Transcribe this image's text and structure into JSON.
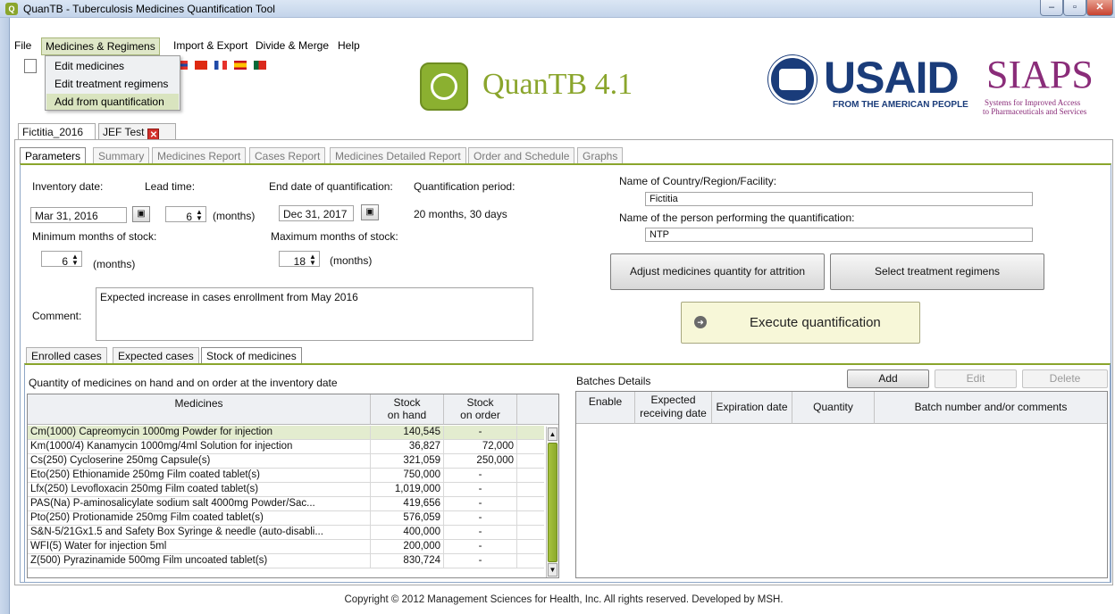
{
  "window": {
    "title": "QuanTB - Tuberculosis Medicines Quantification Tool",
    "minimize_glyph": "–",
    "maximize_glyph": "▫",
    "close_glyph": "✕"
  },
  "menubar": {
    "items": [
      "File",
      "Medicines & Regimens",
      "Import & Export",
      "Divide & Merge",
      "Help"
    ]
  },
  "dropdown": {
    "items": [
      "Edit medicines",
      "Edit treatment regimens",
      "Add from quantification"
    ],
    "highlighted_index": 2
  },
  "branding": {
    "app_logo_text": "QuanTB 4.1",
    "usaid_text": "USAID",
    "usaid_tagline": "FROM THE AMERICAN PEOPLE",
    "siaps_text": "SIAPS",
    "siaps_line1": "Systems for Improved Access",
    "siaps_line2": "to Pharmaceuticals and Services"
  },
  "doc_tabs": [
    {
      "label": "Fictitia_2016"
    },
    {
      "label": "JEF Test"
    }
  ],
  "subtabs": [
    "Parameters",
    "Summary",
    "Medicines Report",
    "Cases Report",
    "Medicines Detailed Report",
    "Order and Schedule",
    "Graphs"
  ],
  "params": {
    "inventory_date_label": "Inventory date:",
    "inventory_date": "Mar 31, 2016",
    "lead_time_label": "Lead time:",
    "lead_time": "6",
    "lead_time_unit": "(months)",
    "end_date_label": "End date of quantification:",
    "end_date": "Dec 31, 2017",
    "period_label": "Quantification period:",
    "period_value": "20 months, 30 days",
    "min_stock_label": "Minimum months of stock:",
    "min_stock": "6",
    "min_stock_unit": "(months)",
    "max_stock_label": "Maximum months of stock:",
    "max_stock": "18",
    "max_stock_unit": "(months)",
    "comment_label": "Comment:",
    "comment": "Expected increase in cases enrollment from May 2016",
    "country_label": "Name of Country/Region/Facility:",
    "country": "Fictitia",
    "person_label": "Name of the person performing the quantification:",
    "person": "NTP",
    "attrition_button": "Adjust medicines quantity for attrition",
    "regimens_button": "Select treatment regimens",
    "execute_button": "Execute quantification"
  },
  "lower_tabs": [
    "Enrolled cases",
    "Expected cases",
    "Stock of medicines"
  ],
  "stock": {
    "heading": "Quantity of medicines on hand and on order at the inventory date",
    "col_medicines": "Medicines",
    "col_on_hand_1": "Stock",
    "col_on_hand_2": "on hand",
    "col_on_order_1": "Stock",
    "col_on_order_2": "on order",
    "rows": [
      {
        "medicine": "Cm(1000)  Capreomycin  1000mg  Powder for injection",
        "on_hand": "140,545",
        "on_order": "-"
      },
      {
        "medicine": "Km(1000/4)  Kanamycin  1000mg/4ml  Solution for injection",
        "on_hand": "36,827",
        "on_order": "72,000"
      },
      {
        "medicine": "Cs(250)  Cycloserine  250mg  Capsule(s)",
        "on_hand": "321,059",
        "on_order": "250,000"
      },
      {
        "medicine": "Eto(250)  Ethionamide  250mg  Film coated tablet(s)",
        "on_hand": "750,000",
        "on_order": "-"
      },
      {
        "medicine": "Lfx(250)  Levofloxacin  250mg  Film coated tablet(s)",
        "on_hand": "1,019,000",
        "on_order": "-"
      },
      {
        "medicine": "PAS(Na)  P-aminosalicylate sodium salt  4000mg  Powder/Sac...",
        "on_hand": "419,656",
        "on_order": "-"
      },
      {
        "medicine": "Pto(250)  Protionamide  250mg  Film coated tablet(s)",
        "on_hand": "576,059",
        "on_order": "-"
      },
      {
        "medicine": "S&N-5/21Gx1.5 and Safety Box  Syringe & needle (auto-disabli...",
        "on_hand": "400,000",
        "on_order": "-"
      },
      {
        "medicine": "WFI(5)  Water for injection  5ml",
        "on_hand": "200,000",
        "on_order": "-"
      },
      {
        "medicine": "Z(500)  Pyrazinamide  500mg  Film uncoated tablet(s)",
        "on_hand": "830,724",
        "on_order": "-"
      }
    ]
  },
  "batches": {
    "heading": "Batches Details",
    "add": "Add",
    "edit": "Edit",
    "delete": "Delete",
    "col_enable": "Enable",
    "col_expected_1": "Expected",
    "col_expected_2": "receiving date",
    "col_expiration": "Expiration date",
    "col_quantity": "Quantity",
    "col_batch": "Batch number and/or comments"
  },
  "footer": "Copyright © 2012 Management Sciences for Health, Inc. All rights reserved. Developed by MSH."
}
